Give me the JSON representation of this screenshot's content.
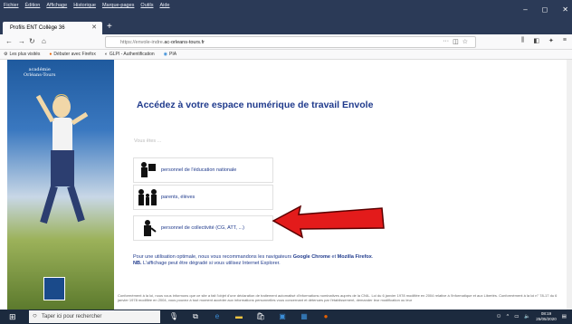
{
  "browser": {
    "menu": [
      "Fichier",
      "Édition",
      "Affichage",
      "Historique",
      "Marque-pages",
      "Outils",
      "Aide"
    ],
    "tab_title": "Profils ENT Collège 36",
    "url_prefix": "https://envole-indre.",
    "url_domain": "ac-orleans-tours.fr",
    "bookmarks": [
      "Les plus visités",
      "Débuter avec Firefox",
      "GLPI - Authentification",
      "PIA"
    ],
    "window_controls": [
      "–",
      "◻",
      "✕"
    ]
  },
  "page": {
    "logo_text": "académie\nOrléans-Tours",
    "heading": "Accédez à votre espace numérique de travail Envole",
    "vous_etes": "Vous êtes ...",
    "choices": [
      {
        "label": "personnel de l'éducation nationale",
        "icon": "teacher-icon"
      },
      {
        "label": "parents, élèves",
        "icon": "family-icon"
      },
      {
        "label": "personnel de collectivité (CG, ATT, ...)",
        "icon": "worker-icon"
      }
    ],
    "info_line1_pre": "Pour une utilisation optimale, nous vous recommandons les navigateurs ",
    "info_chrome": "Google Chrome",
    "info_et": " et ",
    "info_firefox": "Mozilla Firefox",
    "info_nb": "NB.",
    "info_line2": " L'affichage peut être dégradé si vous utilisez Internet Explorer.",
    "footer": "Conformément à la loi, nous vous informons que ce site a fait l'objet d'une déclaration de traitement automatisé d'informations nominatives auprès de la CNIL. Loi du 6 janvier 1978 modifiée en 2004 relative à l'informatique et aux Libertés. Conformément à la loi n° 78-17 du 6 janvier 1978 modifiée en 2004, vous pouvez à tout moment accéder aux informations personnelles vous concernant et détenues par l'établissement, demander leur modification ou leur"
  },
  "taskbar": {
    "search_placeholder": "Taper ici pour rechercher",
    "time": "08:19",
    "date": "25/05/2020"
  },
  "colors": {
    "heading": "#1f3a8c",
    "arrow": "#e31b1b",
    "titlebar": "#2b3a57"
  }
}
